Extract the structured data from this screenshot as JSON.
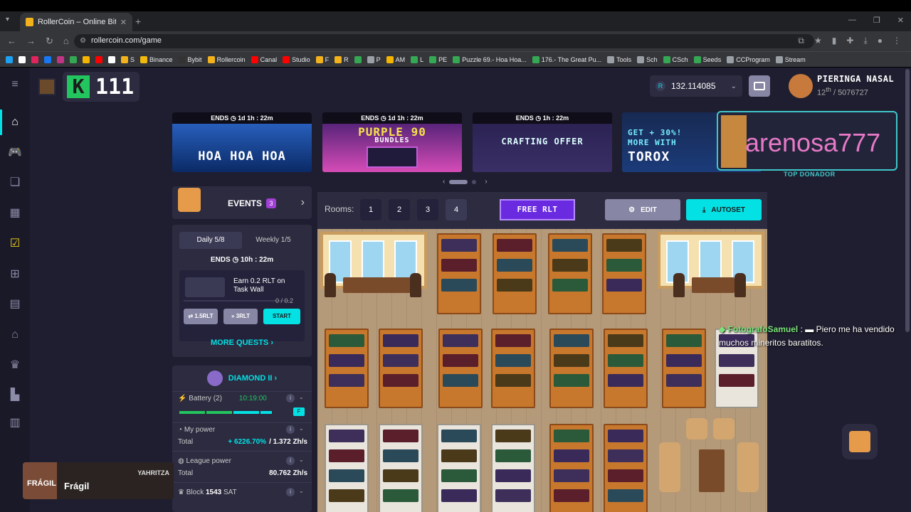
{
  "browser": {
    "tab_title": "RollerCoin – Online Bitcoin Mi...",
    "url": "rollercoin.com/game",
    "bookmarks": [
      {
        "label": "",
        "color": "#1da1f2"
      },
      {
        "label": "",
        "color": "#ffffff"
      },
      {
        "label": "",
        "color": "#e0245e"
      },
      {
        "label": "",
        "color": "#1877f2"
      },
      {
        "label": "",
        "color": "#c13584"
      },
      {
        "label": "",
        "color": "#34a853"
      },
      {
        "label": "",
        "color": "#f4b400"
      },
      {
        "label": "",
        "color": "#ff0000"
      },
      {
        "label": "",
        "color": "#ffffff"
      },
      {
        "label": "S",
        "color": "#f2b21c"
      },
      {
        "label": "Binance",
        "color": "#f0b90b"
      },
      {
        "label": "Bybit",
        "color": "#333333"
      },
      {
        "label": "Rollercoin",
        "color": "#f2b21c"
      },
      {
        "label": "Canal",
        "color": "#ff0000"
      },
      {
        "label": "Studio",
        "color": "#ff0000"
      },
      {
        "label": "F",
        "color": "#f2b21c"
      },
      {
        "label": "R",
        "color": "#f2b21c"
      },
      {
        "label": "",
        "color": "#34a853"
      },
      {
        "label": "P",
        "color": "#9aa0a6"
      },
      {
        "label": "AM",
        "color": "#f4b400"
      },
      {
        "label": "L",
        "color": "#34a853"
      },
      {
        "label": "PE",
        "color": "#34a853"
      },
      {
        "label": "Puzzle 69.- Hoa Hoa...",
        "color": "#34a853"
      },
      {
        "label": "176.- The Great Pu...",
        "color": "#34a853"
      },
      {
        "label": "Tools",
        "color": "#9aa0a6"
      },
      {
        "label": "Sch",
        "color": "#9aa0a6"
      },
      {
        "label": "CSch",
        "color": "#34a853"
      },
      {
        "label": "Seeds",
        "color": "#34a853"
      },
      {
        "label": "CCProgram",
        "color": "#9aa0a6"
      },
      {
        "label": "Stream",
        "color": "#9aa0a6"
      }
    ]
  },
  "header": {
    "level": "111",
    "balance": "132.114085",
    "currency_letter": "R",
    "username": "PIERINGA NASAL",
    "rank_sup": "th",
    "rank_num": "12",
    "rank_total": "/ 5076727"
  },
  "banners": [
    {
      "ends_label": "ENDS",
      "time": "1d 1h : 22m",
      "title": "HOA HOA HOA"
    },
    {
      "ends_label": "ENDS",
      "time": "1d 1h : 22m",
      "title": "PURPLE 90",
      "sub": "BUNDLES"
    },
    {
      "ends_label": "ENDS",
      "time": "1h : 22m",
      "title": "CRAFTING OFFER"
    },
    {
      "line1": "GET + 30%!",
      "line2": "MORE WITH",
      "line3": "TOROX"
    }
  ],
  "streamer": {
    "name": "arenosa777",
    "label": "TOP DONADOR"
  },
  "events": {
    "label": "EVENTS",
    "count": "3"
  },
  "quests": {
    "tab_daily": "Daily  5/8",
    "tab_weekly": "Weekly  1/5",
    "ends_label": "ENDS",
    "ends_time": "10h : 22m",
    "task": "Earn 0.2 RLT on Task Wall",
    "progress": "0 / 0.2",
    "progress_fraction": 0,
    "btn1": "⇄ 1.5RLT",
    "btn2": "» 3RLT",
    "start": "START",
    "more": "MORE QUESTS  ›"
  },
  "league": {
    "name": "DIAMOND II  ›",
    "battery_label": "Battery (2)",
    "battery_time": "10:19:00",
    "my_power_label": "My power",
    "total_label": "Total",
    "my_power_pct": "+ 6226.70%",
    "my_power_total": "/  1.372 Zh/s",
    "league_power_label": "League power",
    "league_total": "80.762 Zh/s",
    "block_label": "Block",
    "block_num": "1543",
    "block_unit": "SAT"
  },
  "game": {
    "rooms_label": "Rooms:",
    "rooms": [
      "1",
      "2",
      "3",
      "4"
    ],
    "free_rlt": "FREE RLT",
    "edit": "EDIT",
    "autoset": "AUTOSET"
  },
  "chat": {
    "user": "FotografoSamuel",
    "message": "Piero me ha vendido muchos mineritos baratitos."
  },
  "music": {
    "art_text": "FRÁGIL",
    "song": "Frágil",
    "artist": "YAHRITZA"
  },
  "colors": {
    "bg": "#1f1e30",
    "panel": "#2c2b40",
    "accent": "#03e1e4",
    "purple": "#6a2be0"
  }
}
